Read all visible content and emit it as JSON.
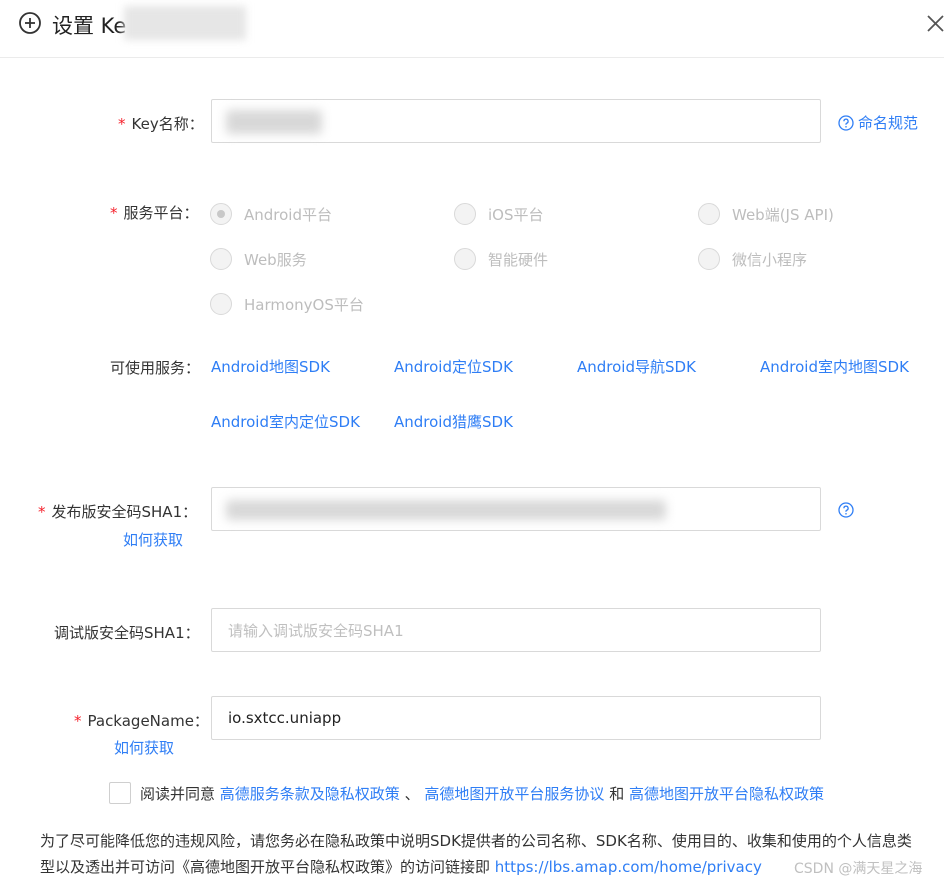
{
  "dialog": {
    "title": "设置 Ke",
    "icons": {
      "add": "plus-circle-icon",
      "close": "close-icon"
    }
  },
  "form": {
    "key_name": {
      "label": "Key名称：",
      "help_link": "命名规范"
    },
    "platform": {
      "label": "服务平台：",
      "options": [
        "Android平台",
        "iOS平台",
        "Web端(JS API)",
        "Web服务",
        "智能硬件",
        "微信小程序",
        "HarmonyOS平台"
      ],
      "selected": "Android平台"
    },
    "services": {
      "label": "可使用服务：",
      "items": [
        "Android地图SDK",
        "Android定位SDK",
        "Android导航SDK",
        "Android室内地图SDK",
        "Android室内定位SDK",
        "Android猎鹰SDK"
      ]
    },
    "release_sha1": {
      "label": "发布版安全码SHA1：",
      "how_link": "如何获取"
    },
    "debug_sha1": {
      "label": "调试版安全码SHA1：",
      "placeholder": "请输入调试版安全码SHA1"
    },
    "package_name": {
      "label": "PackageName：",
      "value": "io.sxtcc.uniapp",
      "how_link": "如何获取"
    }
  },
  "agreement": {
    "prefix": "阅读并同意",
    "link1": "高德服务条款及隐私权政策",
    "sep1": "、",
    "link2": "高德地图开放平台服务协议",
    "sep2": "和",
    "link3": "高德地图开放平台隐私权政策"
  },
  "notice": {
    "text": "为了尽可能降低您的违规风险，请您务必在隐私政策中说明SDK提供者的公司名称、SDK名称、使用目的、收集和使用的个人信息类型以及透出并可访问《高德地图开放平台隐私权政策》的访问链接即",
    "link": "https://lbs.amap.com/home/privacy"
  },
  "watermark": "CSDN @满天星之海",
  "colors": {
    "link": "#2f7ef5",
    "required": "#f5222d",
    "disabled": "#bdbdbd"
  }
}
